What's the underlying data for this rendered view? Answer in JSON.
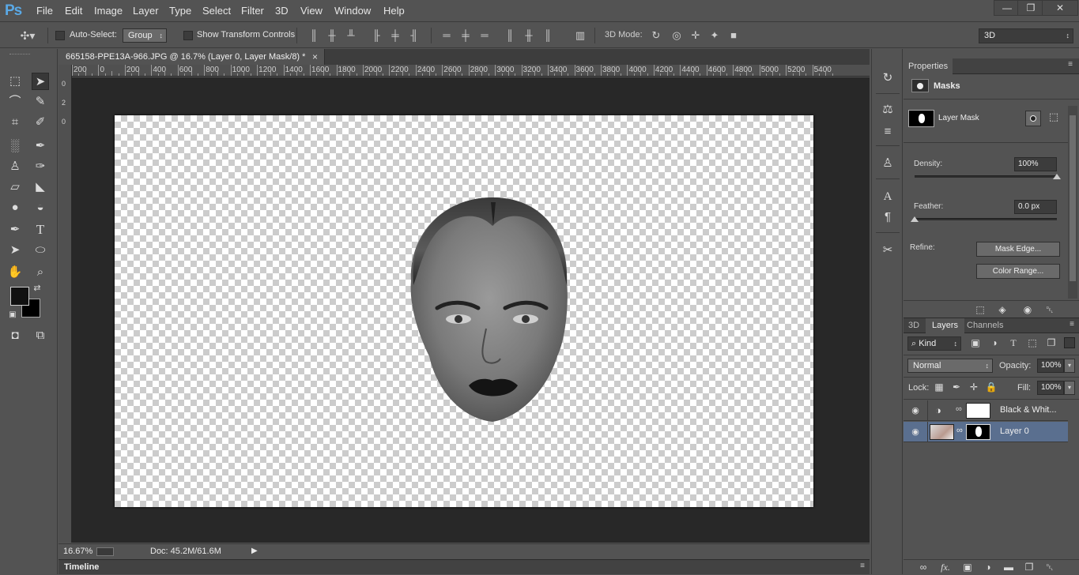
{
  "app": {
    "logo": "Ps"
  },
  "menu": [
    "File",
    "Edit",
    "Image",
    "Layer",
    "Type",
    "Select",
    "Filter",
    "3D",
    "View",
    "Window",
    "Help"
  ],
  "window_controls": {
    "minimize": "—",
    "restore": "❐",
    "close": "✕"
  },
  "options_bar": {
    "auto_select_label": "Auto-Select:",
    "auto_select_value": "Group",
    "show_transform_label": "Show Transform Controls",
    "mode_3d_label": "3D Mode:",
    "workspace_value": "3D"
  },
  "document": {
    "tab_title": "665158-PPE13A-966.JPG @ 16.7% (Layer 0, Layer Mask/8) *",
    "close_glyph": "×"
  },
  "ruler_top_labels": [
    "200",
    "0",
    "200",
    "400",
    "600",
    "800",
    "1000",
    "1200",
    "1400",
    "1600",
    "1800",
    "2000",
    "2200",
    "2400",
    "2600",
    "2800",
    "3000",
    "3200",
    "3400",
    "3600",
    "3800",
    "4000",
    "4200",
    "4400",
    "4600",
    "4800",
    "5000",
    "5200",
    "5400"
  ],
  "status": {
    "zoom": "16.67%",
    "doc_info": "Doc: 45.2M/61.6M",
    "arrow": "▶"
  },
  "timeline_label": "Timeline",
  "properties": {
    "tab": "Properties",
    "section": "Masks",
    "mask_name": "Layer Mask",
    "density_label": "Density:",
    "density_value": "100%",
    "density_level_percent": 100,
    "feather_label": "Feather:",
    "feather_value": "0.0 px",
    "feather_level_percent": 0,
    "refine_label": "Refine:",
    "mask_edge_button": "Mask Edge...",
    "color_range_button": "Color Range..."
  },
  "layers_panel": {
    "tabs": [
      "3D",
      "Layers",
      "Channels"
    ],
    "active_tab": "Layers",
    "filter_kind": "Kind",
    "blend_mode": "Normal",
    "opacity_label": "Opacity:",
    "opacity_value": "100%",
    "lock_label": "Lock:",
    "fill_label": "Fill:",
    "fill_value": "100%",
    "layers": [
      {
        "name": "Black & Whit...",
        "type": "adjustment",
        "visible": true,
        "selected": false
      },
      {
        "name": "Layer 0",
        "type": "pixel",
        "visible": true,
        "selected": true
      }
    ]
  },
  "colors": {
    "accent": "#5aa9e6",
    "selected_layer": "#5a6f8f",
    "panel_bg": "#535353",
    "workspace_bg": "#282828"
  }
}
